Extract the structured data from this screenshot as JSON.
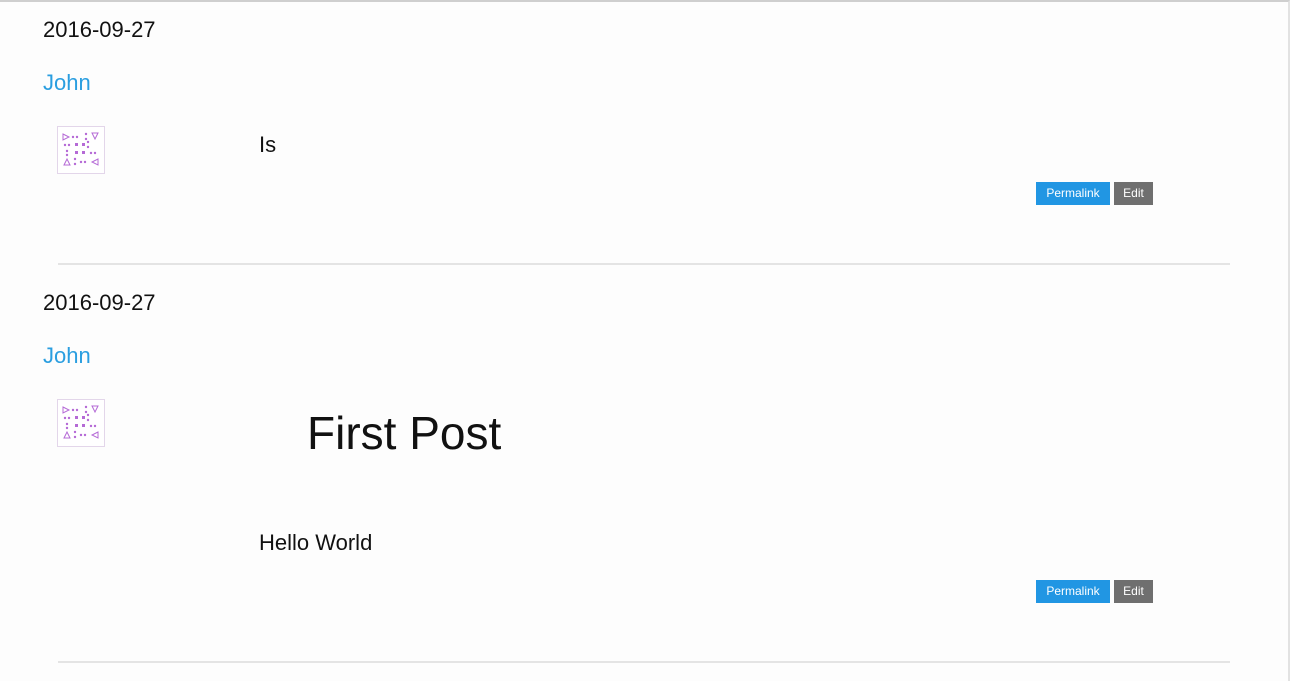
{
  "posts": [
    {
      "date": "2016-09-27",
      "author": "John",
      "heading": "",
      "body": "Is",
      "permalink_label": "Permalink",
      "edit_label": "Edit"
    },
    {
      "date": "2016-09-27",
      "author": "John",
      "heading": "First Post",
      "body": "Hello World",
      "permalink_label": "Permalink",
      "edit_label": "Edit"
    }
  ],
  "colors": {
    "link": "#2a9ee0",
    "permalink_button": "#2196e3",
    "edit_button": "#6f6f6f",
    "avatar_identicon": "#b56ad6"
  },
  "icons": {
    "avatar": "identicon-avatar-icon"
  }
}
